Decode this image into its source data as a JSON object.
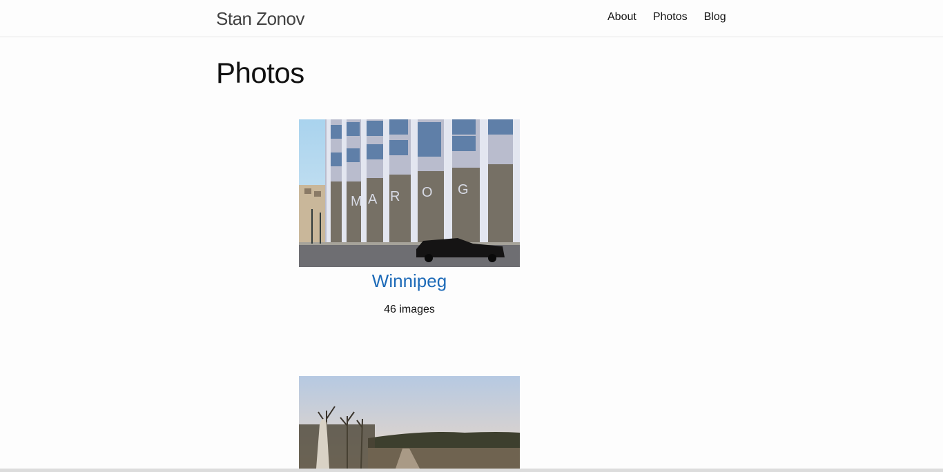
{
  "header": {
    "site_title": "Stan Zonov",
    "nav": [
      {
        "label": "About"
      },
      {
        "label": "Photos"
      },
      {
        "label": "Blog"
      }
    ]
  },
  "main": {
    "title": "Photos",
    "albums": [
      {
        "name": "Winnipeg",
        "count": "46 images",
        "thumbnail": "building-street-photo"
      },
      {
        "name": "",
        "count": "",
        "thumbnail": "landscape-photo"
      }
    ]
  }
}
